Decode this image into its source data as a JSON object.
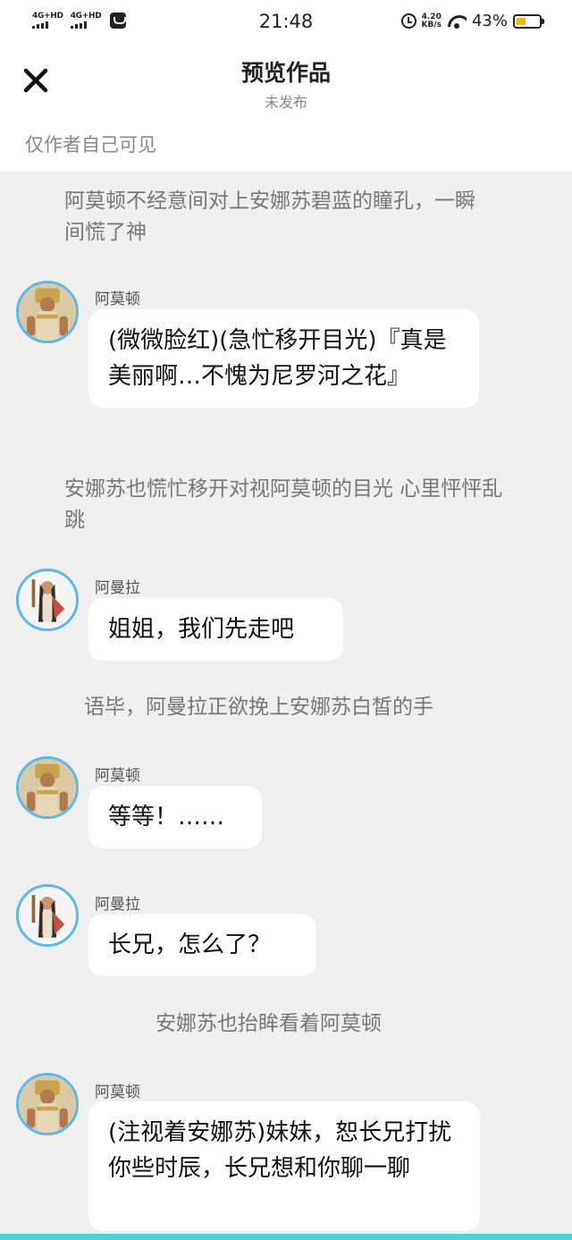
{
  "status_bar": {
    "signal1": "4G+HD",
    "signal2": "4G+HD",
    "time": "21:48",
    "speed_value": "4.20",
    "speed_unit": "KB/s",
    "battery_percent": "43%",
    "battery_level": 0.43
  },
  "header": {
    "title": "预览作品",
    "subtitle": "未发布",
    "visibility_note": "仅作者自己可见"
  },
  "colors": {
    "avatar_ring": "#5cb8e8",
    "battery_fill": "#f2b705",
    "bottom_bar": "#4fd1d9",
    "page_background": "#efefef"
  },
  "story": {
    "narration_1": "阿莫顿不经意间对上安娜苏碧蓝的瞳孔，一瞬间慌了神",
    "speaker_1": "阿莫顿",
    "message_1": "(微微脸红)(急忙移开目光)『真是美丽啊…不愧为尼罗河之花』",
    "narration_2": "安娜苏也慌忙移开对视阿莫顿的目光 心里怦怦乱跳",
    "speaker_2": "阿曼拉",
    "message_2": "姐姐，我们先走吧",
    "narration_3": "语毕，阿曼拉正欲挽上安娜苏白皙的手",
    "speaker_3": "阿莫顿",
    "message_3": "等等！……",
    "speaker_4": "阿曼拉",
    "message_4": "长兄，怎么了？",
    "narration_4": "安娜苏也抬眸看着阿莫顿",
    "speaker_5": "阿莫顿",
    "message_5": "(注视着安娜苏)妹妹，恕长兄打扰你些时辰，长兄想和你聊一聊"
  }
}
